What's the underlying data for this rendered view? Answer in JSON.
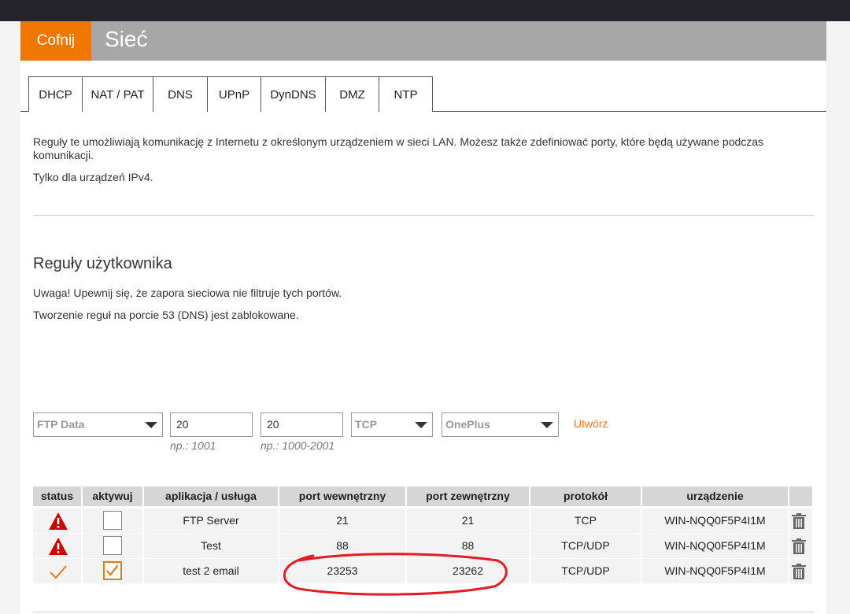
{
  "header": {
    "back_label": "Cofnij",
    "title": "Sieć"
  },
  "tabs": [
    "DHCP",
    "NAT / PAT",
    "DNS",
    "UPnP",
    "DynDNS",
    "DMZ",
    "NTP"
  ],
  "intro": {
    "description": "Reguły te umożliwiają komunikację z Internetu z określonym urządzeniem w sieci LAN. Możesz także zdefiniować porty, które będą używane podczas komunikacji.",
    "ipv4_note": "Tylko dla urządzeń IPv4."
  },
  "user_rules": {
    "title": "Reguły użytkownika",
    "warning": "Uwaga! Upewnij się, że zapora sieciowa nie filtruje tych portów.",
    "dns_note": "Tworzenie reguł na porcie 53 (DNS) jest zablokowane."
  },
  "form": {
    "service_select": "FTP Data",
    "internal_port": "20",
    "internal_hint": "np.: 1001",
    "external_port": "20",
    "external_hint": "np.: 1000-2001",
    "protocol_select": "TCP",
    "device_select": "OnePlus",
    "create_label": "Utwórz"
  },
  "table": {
    "headers": [
      "status",
      "aktywuj",
      "aplikacja / usługa",
      "port wewnętrzny",
      "port zewnętrzny",
      "protokół",
      "urządzenie",
      ""
    ],
    "rows": [
      {
        "status": "warning-icon",
        "active": false,
        "service": "FTP Server",
        "internal": "21",
        "external": "21",
        "protocol": "TCP",
        "device": "WIN-NQQ0F5P4I1M"
      },
      {
        "status": "warning-icon",
        "active": false,
        "service": "Test",
        "internal": "88",
        "external": "88",
        "protocol": "TCP/UDP",
        "device": "WIN-NQQ0F5P4I1M"
      },
      {
        "status": "checkmark-icon",
        "active": true,
        "service": "test 2 email",
        "internal": "23253",
        "external": "23262",
        "protocol": "TCP/UDP",
        "device": "WIN-NQQ0F5P4I1M"
      }
    ]
  },
  "colors": {
    "accent": "#ef7700",
    "header_bg": "#a7a7a7",
    "warning": "#cc0000",
    "annotation": "#e31b23"
  }
}
